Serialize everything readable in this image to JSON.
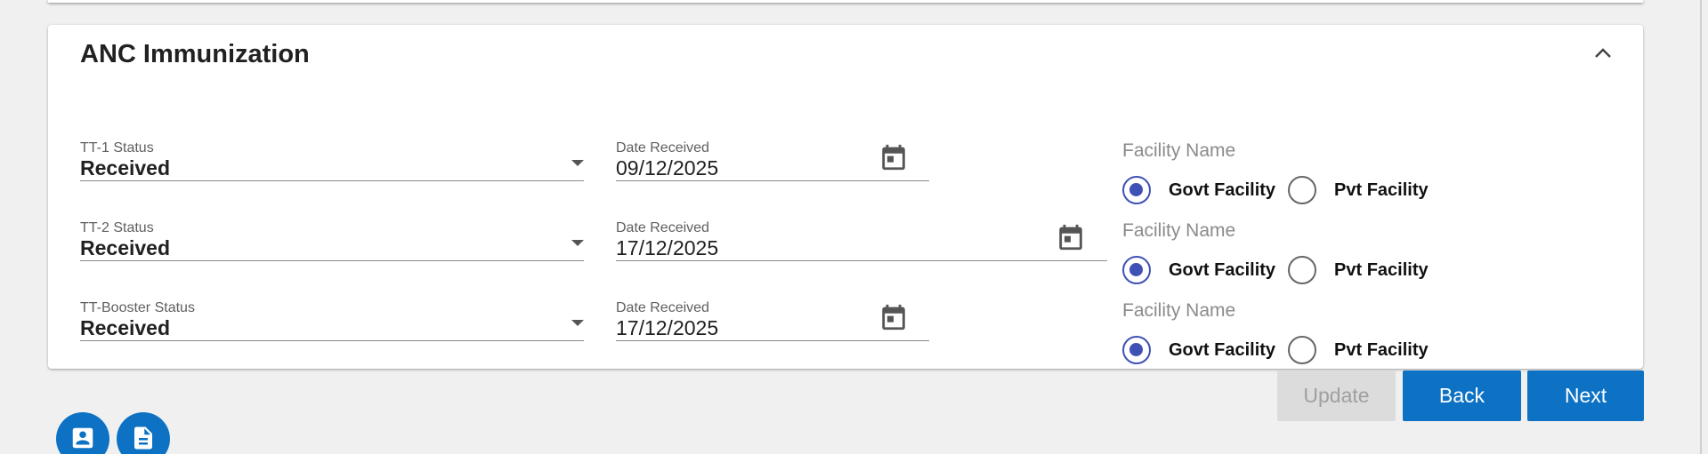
{
  "section": {
    "title": "ANC Immunization"
  },
  "rows": [
    {
      "status_label": "TT-1 Status",
      "status_value": "Received",
      "date_label": "Date Received",
      "date_value": "09/12/2025",
      "facility_label": "Facility Name",
      "facility_options": [
        "Govt Facility",
        "Pvt Facility"
      ],
      "facility_selected": "Govt Facility"
    },
    {
      "status_label": "TT-2 Status",
      "status_value": "Received",
      "date_label": "Date Received",
      "date_value": "17/12/2025",
      "facility_label": "Facility Name",
      "facility_options": [
        "Govt Facility",
        "Pvt Facility"
      ],
      "facility_selected": "Govt Facility"
    },
    {
      "status_label": "TT-Booster Status",
      "status_value": "Received",
      "date_label": "Date Received",
      "date_value": "17/12/2025",
      "facility_label": "Facility Name",
      "facility_options": [
        "Govt Facility",
        "Pvt Facility"
      ],
      "facility_selected": "Govt Facility"
    }
  ],
  "actions": {
    "update_label": "Update",
    "back_label": "Back",
    "next_label": "Next"
  },
  "icons": {
    "collapse": "chevron-up-icon",
    "calendar": "calendar-icon",
    "fab_profile": "contact-card-icon",
    "fab_document": "document-icon"
  },
  "colors": {
    "primary": "#0d72c4",
    "radio_selected": "#3f51b5",
    "disabled_bg": "#dcdcdc"
  }
}
